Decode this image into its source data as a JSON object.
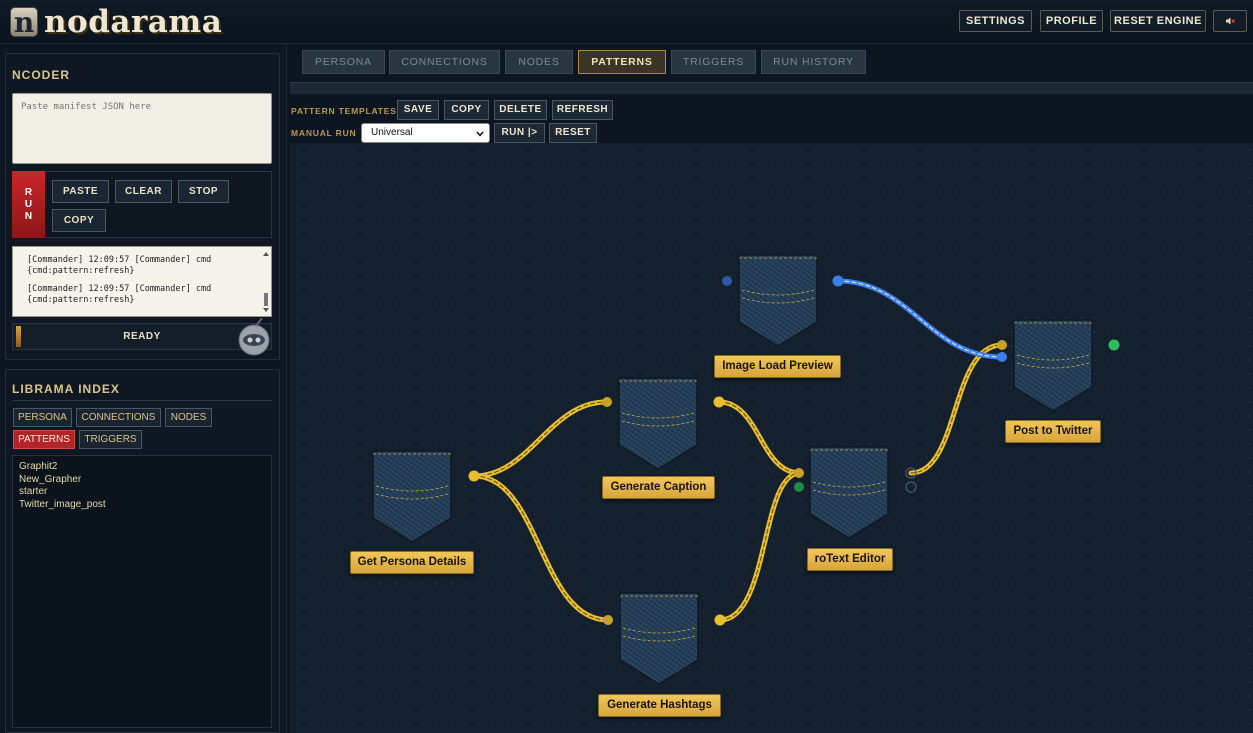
{
  "header": {
    "logo_letter": "n",
    "logo_text": "nodarama",
    "buttons": [
      "SETTINGS",
      "PROFILE",
      "RESET ENGINE"
    ],
    "mute_icon": "speaker-mute-icon"
  },
  "ncoder": {
    "title": "NCODER",
    "placeholder": "Paste manifest JSON here",
    "run_label": "R\nU\nN",
    "buttons": {
      "paste": "PASTE",
      "clear": "CLEAR",
      "stop": "STOP",
      "copy": "COPY"
    },
    "log": [
      "[Commander] 12:09:57 [Commander] cmd\n{cmd:pattern:refresh}",
      "[Commander] 12:09:57 [Commander] cmd\n{cmd:pattern:refresh}"
    ],
    "status": "READY"
  },
  "librama": {
    "title": "LIBRAMA INDEX",
    "tabs": [
      "PERSONA",
      "CONNECTIONS",
      "NODES",
      "PATTERNS",
      "TRIGGERS"
    ],
    "active_tab": "PATTERNS",
    "items": [
      "Graphit2",
      "New_Grapher",
      "starter",
      "Twitter_image_post"
    ]
  },
  "main": {
    "tabs": [
      "PERSONA",
      "CONNECTIONS",
      "NODES",
      "PATTERNS",
      "TRIGGERS",
      "RUN HISTORY"
    ],
    "active_tab": "PATTERNS",
    "pattern_templates_label": "PATTERN TEMPLATES",
    "template_buttons": [
      "SAVE",
      "COPY",
      "DELETE",
      "REFRESH"
    ],
    "manual_run_label": "MANUAL RUN",
    "manual_run_select": "Universal",
    "run_button": "RUN |>",
    "reset_button": "RESET"
  },
  "graph": {
    "nodes": [
      "Image Load Preview",
      "Post to Twitter",
      "Generate Caption",
      "roText Editor",
      "Get Persona Details",
      "Generate Hashtags"
    ],
    "colors": {
      "gold_wire": "#e8bf2e",
      "blue_wire": "#3d7ee8",
      "port_green": "#2ebd5a",
      "label": "#e5b448"
    }
  }
}
